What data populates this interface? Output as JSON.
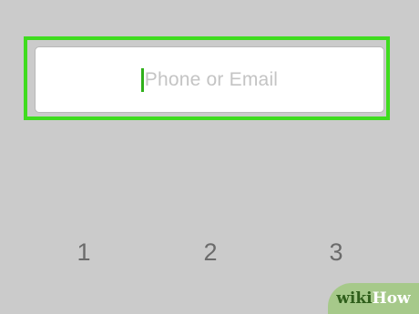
{
  "login": {
    "phone_email_placeholder": "Phone or Email"
  },
  "keypad": {
    "keys": [
      "1",
      "2",
      "3"
    ]
  },
  "watermark": {
    "part1": "wiki",
    "part2": "How"
  },
  "colors": {
    "background": "#cbcbcb",
    "highlight": "#3fdc1f",
    "caret": "#2fb01a",
    "placeholder": "#c4c4c4",
    "key_text": "#6b6b6b"
  }
}
